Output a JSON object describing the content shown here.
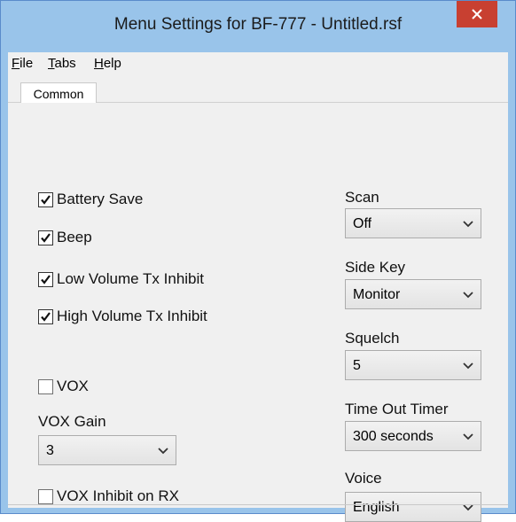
{
  "window": {
    "title": "Menu Settings for BF-777 - Untitled.rsf",
    "close_glyph": "✕"
  },
  "menubar": {
    "items": [
      {
        "mnemonic": "F",
        "rest": "ile"
      },
      {
        "mnemonic": "T",
        "rest": "abs"
      },
      {
        "mnemonic": "H",
        "rest": "elp"
      }
    ]
  },
  "tabs": [
    {
      "label": "Common",
      "selected": true
    }
  ],
  "common": {
    "checkboxes": [
      {
        "label": "Battery Save",
        "checked": true
      },
      {
        "label": "Beep",
        "checked": true
      },
      {
        "label": "Low Volume Tx Inhibit",
        "checked": true
      },
      {
        "label": "High Volume Tx Inhibit",
        "checked": true
      },
      {
        "label": "VOX",
        "checked": false
      },
      {
        "label": "VOX Inhibit on RX",
        "checked": false
      }
    ],
    "vox_gain": {
      "label": "VOX Gain",
      "value": "3"
    },
    "right_selects": [
      {
        "label": "Scan",
        "value": "Off"
      },
      {
        "label": "Side Key",
        "value": "Monitor"
      },
      {
        "label": "Squelch",
        "value": "5"
      },
      {
        "label": "Time Out Timer",
        "value": "300 seconds"
      },
      {
        "label": "Voice",
        "value": "English"
      }
    ]
  },
  "colors": {
    "window_frame": "#99c4ea",
    "close_button": "#c84031",
    "client_background": "#f0f0f0"
  }
}
